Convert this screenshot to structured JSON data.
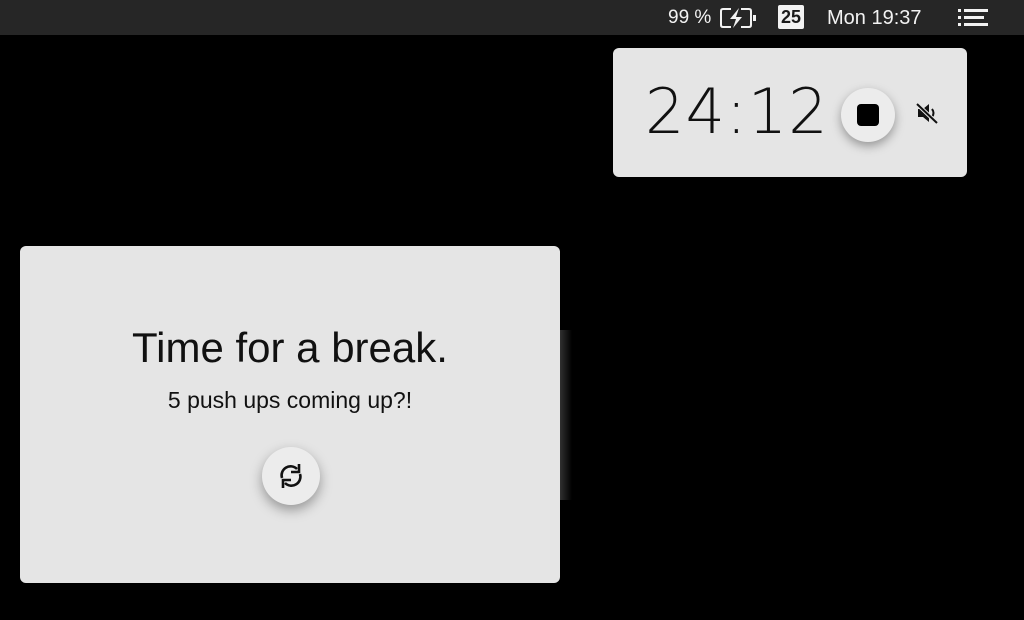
{
  "menubar": {
    "battery_percent": "99 %",
    "battery_icon": "battery-charging-icon",
    "date_badge": "25",
    "clock": "Mon 19:37",
    "menu_icon": "list-menu-icon"
  },
  "timer": {
    "time": "24:12",
    "stop_icon": "stop-icon",
    "mute_icon": "volume-off-icon"
  },
  "break_card": {
    "title": "Time for a break.",
    "subtitle": "5 push ups coming up?!",
    "refresh_icon": "refresh-icon"
  },
  "colors": {
    "background": "#000000",
    "menubar": "#262626",
    "card": "#e5e5e5",
    "text": "#111111"
  }
}
